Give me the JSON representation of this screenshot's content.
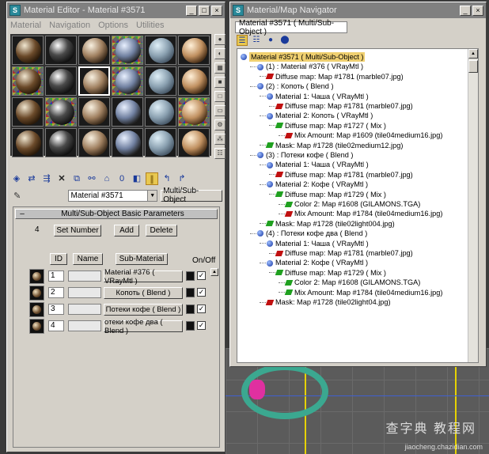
{
  "material_editor": {
    "title": "Material Editor - Material #3571",
    "menu": [
      "Material",
      "Navigation",
      "Options",
      "Utilities"
    ],
    "current_material": "Material #3571",
    "type_button": "Multi/Sub-Object",
    "rollout_title": "Multi/Sub-Object Basic Parameters",
    "count": "4",
    "set_number_label": "Set Number",
    "add_label": "Add",
    "delete_label": "Delete",
    "columns": {
      "id": "ID",
      "name": "Name",
      "submaterial": "Sub-Material",
      "onoff": "On/Off"
    },
    "rows": [
      {
        "id": "1",
        "submaterial": "Material #376  ( VRayMtl )",
        "checked": "✓"
      },
      {
        "id": "2",
        "submaterial": "Копоть  ( Blend )",
        "checked": "✓"
      },
      {
        "id": "3",
        "submaterial": "Потеки кофе  ( Blend )",
        "checked": "✓"
      },
      {
        "id": "4",
        "submaterial": "отеки кофе два  ( Blend )",
        "checked": "✓"
      }
    ]
  },
  "navigator": {
    "title": "Material/Map Navigator",
    "path": "Material #3571  ( Multi/Sub-Object )",
    "tree": [
      {
        "indent": 0,
        "icon": "ball",
        "text": "Material #3571  ( Multi/Sub-Object )",
        "hl": true
      },
      {
        "indent": 1,
        "icon": "ball",
        "text": "(1) : Material #376  ( VRayMtl )"
      },
      {
        "indent": 2,
        "icon": "red",
        "text": "Diffuse map: Map #1781 (marble07.jpg)"
      },
      {
        "indent": 1,
        "icon": "ball",
        "text": "(2) : Копоть  ( Blend )"
      },
      {
        "indent": 2,
        "icon": "ball",
        "text": "Material 1: Чаша  ( VRayMtl )"
      },
      {
        "indent": 3,
        "icon": "red",
        "text": "Diffuse map: Map #1781 (marble07.jpg)"
      },
      {
        "indent": 2,
        "icon": "ball",
        "text": "Material 2: Копоть  ( VRayMtl )"
      },
      {
        "indent": 3,
        "icon": "green",
        "text": "Diffuse map: Map #1727  ( Mix )"
      },
      {
        "indent": 4,
        "icon": "red",
        "text": "Mix Amount: Map #1609 (tile04medium16.jpg)"
      },
      {
        "indent": 2,
        "icon": "green",
        "text": "Mask: Map #1728 (tile02medium12.jpg)"
      },
      {
        "indent": 1,
        "icon": "ball",
        "text": "(3) : Потеки кофе  ( Blend )"
      },
      {
        "indent": 2,
        "icon": "ball",
        "text": "Material 1: Чаша  ( VRayMtl )"
      },
      {
        "indent": 3,
        "icon": "red",
        "text": "Diffuse map: Map #1781 (marble07.jpg)"
      },
      {
        "indent": 2,
        "icon": "ball",
        "text": "Material 2: Кофе  ( VRayMtl )"
      },
      {
        "indent": 3,
        "icon": "green",
        "text": "Diffuse map: Map #1729  ( Mix )"
      },
      {
        "indent": 4,
        "icon": "green",
        "text": "Color 2: Map #1608 (GILAMONS.TGA)"
      },
      {
        "indent": 4,
        "icon": "red",
        "text": "Mix Amount: Map #1784 (tile04medium16.jpg)"
      },
      {
        "indent": 2,
        "icon": "green",
        "text": "Mask: Map #1728 (tile02light004.jpg)"
      },
      {
        "indent": 1,
        "icon": "ball",
        "text": "(4) : Потеки кофе два  ( Blend )"
      },
      {
        "indent": 2,
        "icon": "ball",
        "text": "Material 1: Чаша  ( VRayMtl )"
      },
      {
        "indent": 3,
        "icon": "red",
        "text": "Diffuse map: Map #1781 (marble07.jpg)"
      },
      {
        "indent": 2,
        "icon": "ball",
        "text": "Material 2: Кофе  ( VRayMtl )"
      },
      {
        "indent": 3,
        "icon": "green",
        "text": "Diffuse map: Map #1729  ( Mix )"
      },
      {
        "indent": 4,
        "icon": "green",
        "text": "Color 2: Map #1608 (GILAMONS.TGA)"
      },
      {
        "indent": 4,
        "icon": "green",
        "text": "Mix Amount: Map #1784 (tile04medium16.jpg)"
      },
      {
        "indent": 2,
        "icon": "red",
        "text": "Mask: Map #1728 (tile02light04.jpg)"
      }
    ]
  },
  "watermark": {
    "main": "查字典 教程网",
    "sub": "jiaocheng.chazidian.com"
  },
  "colors": {
    "highlight": "#f0d070",
    "map_red": "#c01010",
    "map_green": "#20a020",
    "title_bar": "#808080"
  }
}
